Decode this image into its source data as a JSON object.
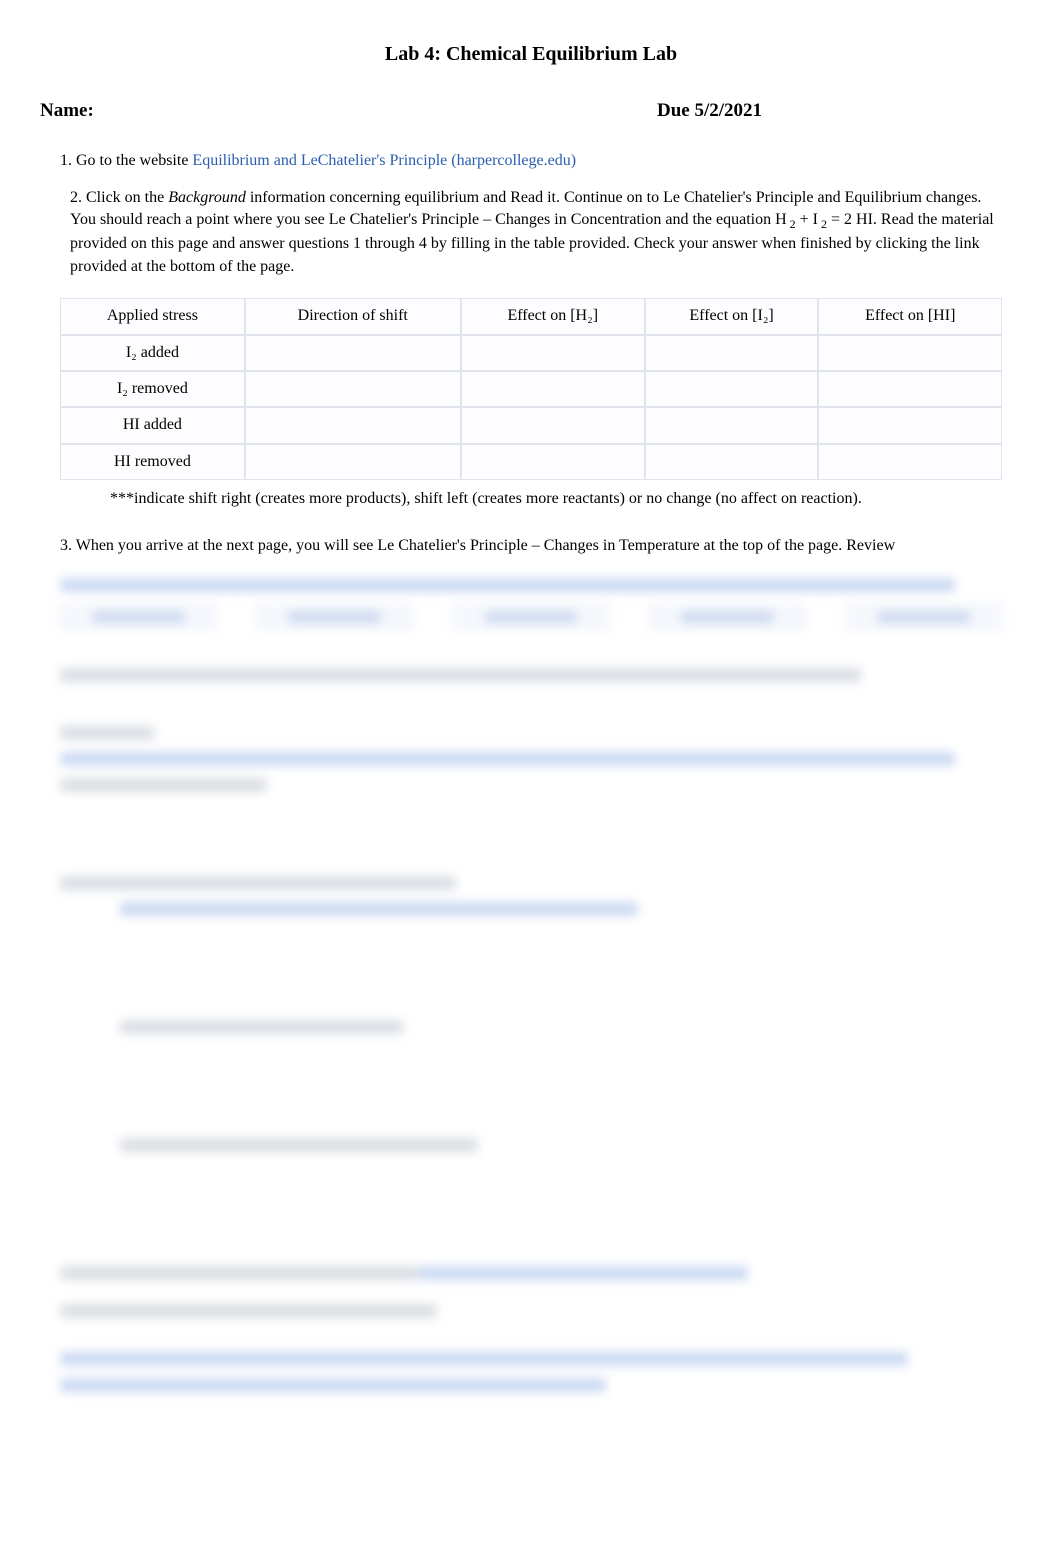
{
  "title": "Lab 4:  Chemical Equilibrium Lab",
  "header": {
    "name_label": "Name:",
    "due_label": "Due 5/2/2021"
  },
  "q1": {
    "prefix": "1. Go to the website ",
    "link_text": "Equilibrium and LeChatelier's Principle (harpercollege.edu)"
  },
  "q2": {
    "text_before_italic": "2. Click on  the ",
    "italic_word": "Background",
    "text_after_italic1": " information concerning equilibrium and Read it. Continue on to Le Chatelier's Principle and Equilibrium changes. You should reach a point where you see Le Chatelier's Principle – Changes in Concentration and the equation H",
    "sub1": " 2",
    "mid1": " + I",
    "sub2": " 2",
    "mid2": " = 2 HI. Read the material provided on this page and answer questions 1 through 4 by filling in the table provided. Check your answer when finished by clicking the link provided at the bottom of the page."
  },
  "table": {
    "headers": [
      "Applied stress",
      "Direction of shift",
      "Effect on [H₂]",
      "Effect on [I₂]",
      "Effect on [HI]"
    ],
    "rows": [
      {
        "stress": "I₂ added",
        "cells": [
          "",
          "",
          "",
          ""
        ]
      },
      {
        "stress": "I₂ removed",
        "cells": [
          "",
          "",
          "",
          ""
        ]
      },
      {
        "stress": "HI added",
        "cells": [
          "",
          "",
          "",
          ""
        ]
      },
      {
        "stress": "HI removed",
        "cells": [
          "",
          "",
          "",
          ""
        ]
      }
    ]
  },
  "table_note": "***indicate shift right (creates more products), shift left (creates more reactants) or no change (no affect on reaction).",
  "q3": {
    "text": "3. When you arrive at the next page, you will see Le Chatelier's Principle – Changes in Temperature at the top of the page. Review"
  }
}
